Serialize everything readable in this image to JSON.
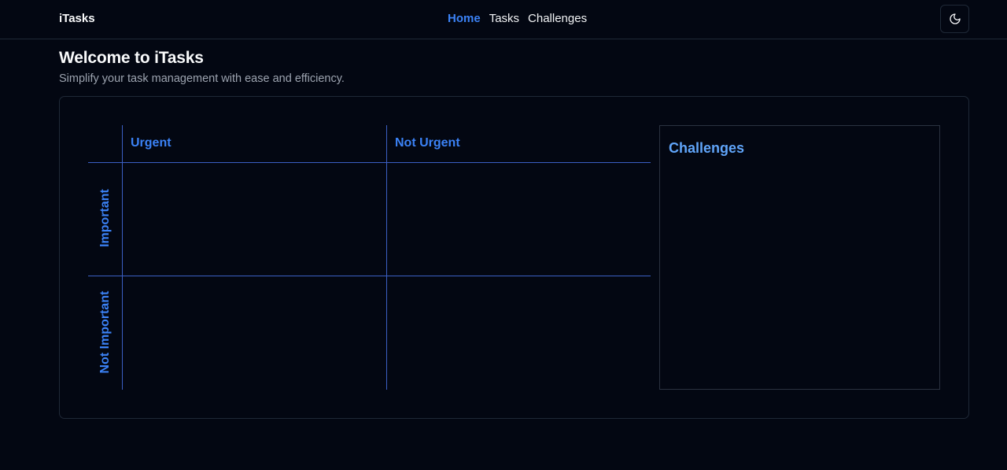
{
  "navbar": {
    "brand": "iTasks",
    "links": [
      {
        "label": "Home",
        "active": true
      },
      {
        "label": "Tasks",
        "active": false
      },
      {
        "label": "Challenges",
        "active": false
      }
    ],
    "theme_toggle_icon": "moon-icon"
  },
  "header": {
    "title": "Welcome to iTasks",
    "subtitle": "Simplify your task management with ease and efficiency."
  },
  "matrix": {
    "columns": [
      "Urgent",
      "Not Urgent"
    ],
    "rows": [
      "Important",
      "Not Important"
    ]
  },
  "challenges": {
    "title": "Challenges"
  },
  "colors": {
    "background": "#030712",
    "accent": "#3b82f6",
    "border": "#1f2937"
  }
}
